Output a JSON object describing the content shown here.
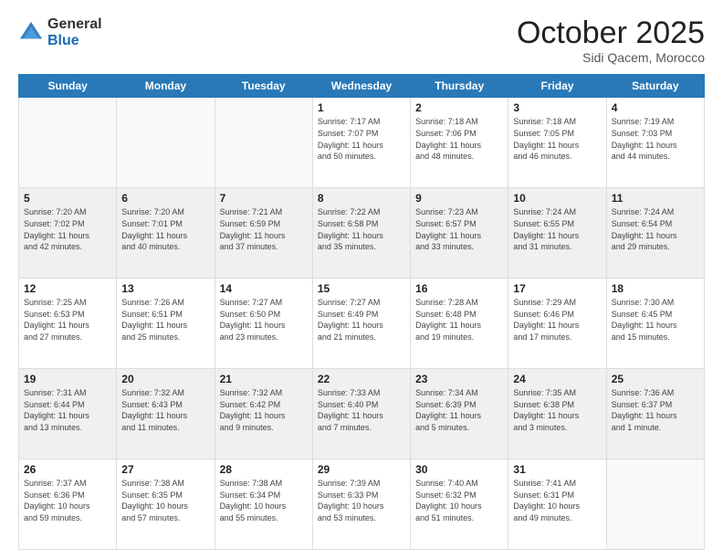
{
  "header": {
    "logo_general": "General",
    "logo_blue": "Blue",
    "title": "October 2025",
    "location": "Sidi Qacem, Morocco"
  },
  "days_of_week": [
    "Sunday",
    "Monday",
    "Tuesday",
    "Wednesday",
    "Thursday",
    "Friday",
    "Saturday"
  ],
  "weeks": [
    [
      {
        "num": "",
        "sunrise": "",
        "sunset": "",
        "daylight": ""
      },
      {
        "num": "",
        "sunrise": "",
        "sunset": "",
        "daylight": ""
      },
      {
        "num": "",
        "sunrise": "",
        "sunset": "",
        "daylight": ""
      },
      {
        "num": "1",
        "sunrise": "Sunrise: 7:17 AM",
        "sunset": "Sunset: 7:07 PM",
        "daylight": "Daylight: 11 hours and 50 minutes."
      },
      {
        "num": "2",
        "sunrise": "Sunrise: 7:18 AM",
        "sunset": "Sunset: 7:06 PM",
        "daylight": "Daylight: 11 hours and 48 minutes."
      },
      {
        "num": "3",
        "sunrise": "Sunrise: 7:18 AM",
        "sunset": "Sunset: 7:05 PM",
        "daylight": "Daylight: 11 hours and 46 minutes."
      },
      {
        "num": "4",
        "sunrise": "Sunrise: 7:19 AM",
        "sunset": "Sunset: 7:03 PM",
        "daylight": "Daylight: 11 hours and 44 minutes."
      }
    ],
    [
      {
        "num": "5",
        "sunrise": "Sunrise: 7:20 AM",
        "sunset": "Sunset: 7:02 PM",
        "daylight": "Daylight: 11 hours and 42 minutes."
      },
      {
        "num": "6",
        "sunrise": "Sunrise: 7:20 AM",
        "sunset": "Sunset: 7:01 PM",
        "daylight": "Daylight: 11 hours and 40 minutes."
      },
      {
        "num": "7",
        "sunrise": "Sunrise: 7:21 AM",
        "sunset": "Sunset: 6:59 PM",
        "daylight": "Daylight: 11 hours and 37 minutes."
      },
      {
        "num": "8",
        "sunrise": "Sunrise: 7:22 AM",
        "sunset": "Sunset: 6:58 PM",
        "daylight": "Daylight: 11 hours and 35 minutes."
      },
      {
        "num": "9",
        "sunrise": "Sunrise: 7:23 AM",
        "sunset": "Sunset: 6:57 PM",
        "daylight": "Daylight: 11 hours and 33 minutes."
      },
      {
        "num": "10",
        "sunrise": "Sunrise: 7:24 AM",
        "sunset": "Sunset: 6:55 PM",
        "daylight": "Daylight: 11 hours and 31 minutes."
      },
      {
        "num": "11",
        "sunrise": "Sunrise: 7:24 AM",
        "sunset": "Sunset: 6:54 PM",
        "daylight": "Daylight: 11 hours and 29 minutes."
      }
    ],
    [
      {
        "num": "12",
        "sunrise": "Sunrise: 7:25 AM",
        "sunset": "Sunset: 6:53 PM",
        "daylight": "Daylight: 11 hours and 27 minutes."
      },
      {
        "num": "13",
        "sunrise": "Sunrise: 7:26 AM",
        "sunset": "Sunset: 6:51 PM",
        "daylight": "Daylight: 11 hours and 25 minutes."
      },
      {
        "num": "14",
        "sunrise": "Sunrise: 7:27 AM",
        "sunset": "Sunset: 6:50 PM",
        "daylight": "Daylight: 11 hours and 23 minutes."
      },
      {
        "num": "15",
        "sunrise": "Sunrise: 7:27 AM",
        "sunset": "Sunset: 6:49 PM",
        "daylight": "Daylight: 11 hours and 21 minutes."
      },
      {
        "num": "16",
        "sunrise": "Sunrise: 7:28 AM",
        "sunset": "Sunset: 6:48 PM",
        "daylight": "Daylight: 11 hours and 19 minutes."
      },
      {
        "num": "17",
        "sunrise": "Sunrise: 7:29 AM",
        "sunset": "Sunset: 6:46 PM",
        "daylight": "Daylight: 11 hours and 17 minutes."
      },
      {
        "num": "18",
        "sunrise": "Sunrise: 7:30 AM",
        "sunset": "Sunset: 6:45 PM",
        "daylight": "Daylight: 11 hours and 15 minutes."
      }
    ],
    [
      {
        "num": "19",
        "sunrise": "Sunrise: 7:31 AM",
        "sunset": "Sunset: 6:44 PM",
        "daylight": "Daylight: 11 hours and 13 minutes."
      },
      {
        "num": "20",
        "sunrise": "Sunrise: 7:32 AM",
        "sunset": "Sunset: 6:43 PM",
        "daylight": "Daylight: 11 hours and 11 minutes."
      },
      {
        "num": "21",
        "sunrise": "Sunrise: 7:32 AM",
        "sunset": "Sunset: 6:42 PM",
        "daylight": "Daylight: 11 hours and 9 minutes."
      },
      {
        "num": "22",
        "sunrise": "Sunrise: 7:33 AM",
        "sunset": "Sunset: 6:40 PM",
        "daylight": "Daylight: 11 hours and 7 minutes."
      },
      {
        "num": "23",
        "sunrise": "Sunrise: 7:34 AM",
        "sunset": "Sunset: 6:39 PM",
        "daylight": "Daylight: 11 hours and 5 minutes."
      },
      {
        "num": "24",
        "sunrise": "Sunrise: 7:35 AM",
        "sunset": "Sunset: 6:38 PM",
        "daylight": "Daylight: 11 hours and 3 minutes."
      },
      {
        "num": "25",
        "sunrise": "Sunrise: 7:36 AM",
        "sunset": "Sunset: 6:37 PM",
        "daylight": "Daylight: 11 hours and 1 minute."
      }
    ],
    [
      {
        "num": "26",
        "sunrise": "Sunrise: 7:37 AM",
        "sunset": "Sunset: 6:36 PM",
        "daylight": "Daylight: 10 hours and 59 minutes."
      },
      {
        "num": "27",
        "sunrise": "Sunrise: 7:38 AM",
        "sunset": "Sunset: 6:35 PM",
        "daylight": "Daylight: 10 hours and 57 minutes."
      },
      {
        "num": "28",
        "sunrise": "Sunrise: 7:38 AM",
        "sunset": "Sunset: 6:34 PM",
        "daylight": "Daylight: 10 hours and 55 minutes."
      },
      {
        "num": "29",
        "sunrise": "Sunrise: 7:39 AM",
        "sunset": "Sunset: 6:33 PM",
        "daylight": "Daylight: 10 hours and 53 minutes."
      },
      {
        "num": "30",
        "sunrise": "Sunrise: 7:40 AM",
        "sunset": "Sunset: 6:32 PM",
        "daylight": "Daylight: 10 hours and 51 minutes."
      },
      {
        "num": "31",
        "sunrise": "Sunrise: 7:41 AM",
        "sunset": "Sunset: 6:31 PM",
        "daylight": "Daylight: 10 hours and 49 minutes."
      },
      {
        "num": "",
        "sunrise": "",
        "sunset": "",
        "daylight": ""
      }
    ]
  ]
}
